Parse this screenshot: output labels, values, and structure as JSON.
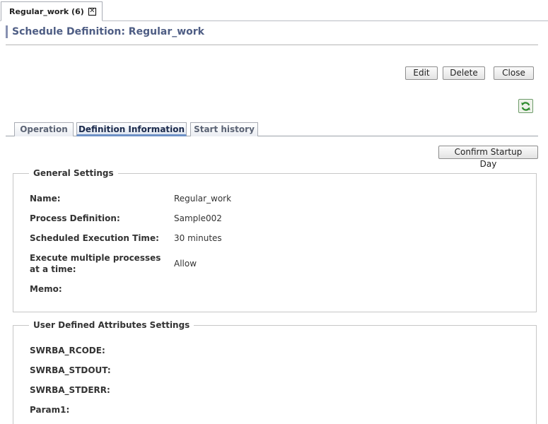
{
  "document_tab": {
    "label": "Regular_work (6)",
    "close_glyph": "✕"
  },
  "page": {
    "title": "Schedule Definition: Regular_work"
  },
  "actions": {
    "edit": "Edit",
    "delete": "Delete",
    "close": "Close",
    "refresh_icon": "refresh-icon"
  },
  "tabs": [
    {
      "label": "Operation",
      "active": false
    },
    {
      "label": "Definition Information",
      "active": true
    },
    {
      "label": "Start history",
      "active": false
    }
  ],
  "confirm_startup_day": "Confirm Startup Day",
  "general": {
    "legend": "General Settings",
    "fields": [
      {
        "label": "Name:",
        "value": "Regular_work"
      },
      {
        "label": "Process Definition:",
        "value": "Sample002"
      },
      {
        "label": "Scheduled Execution Time:",
        "value": "30 minutes"
      },
      {
        "label": "Execute multiple processes at a time:",
        "value": "Allow"
      },
      {
        "label": "Memo:",
        "value": ""
      }
    ]
  },
  "user_defined": {
    "legend": "User Defined Attributes Settings",
    "fields": [
      {
        "label": "SWRBA_RCODE:",
        "value": ""
      },
      {
        "label": "SWRBA_STDOUT:",
        "value": ""
      },
      {
        "label": "SWRBA_STDERR:",
        "value": ""
      },
      {
        "label": "Param1:",
        "value": ""
      }
    ]
  },
  "colors": {
    "title": "#4e5d84",
    "title_bar": "#8791b1",
    "active_tab_underline": "#6d91c6",
    "refresh_green": "#2e8b2e"
  }
}
